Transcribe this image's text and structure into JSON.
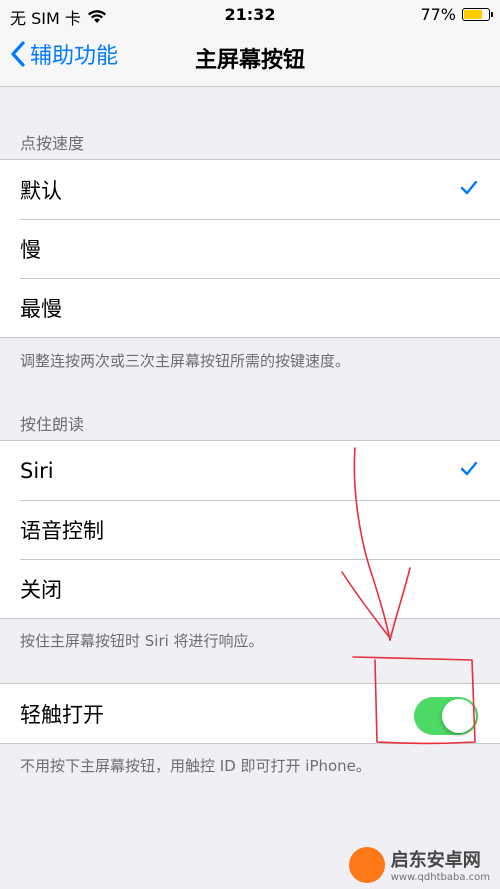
{
  "status": {
    "carrier": "无 SIM 卡",
    "time": "21:32",
    "battery": "77%",
    "battery_level": 0.77
  },
  "nav": {
    "back_label": "辅助功能",
    "title": "主屏幕按钮"
  },
  "click_speed": {
    "header": "点按速度",
    "items": [
      {
        "label": "默认",
        "checked": true
      },
      {
        "label": "慢"
      },
      {
        "label": "最慢"
      }
    ],
    "footer": "调整连按两次或三次主屏幕按钮所需的按键速度。"
  },
  "press_hold": {
    "header": "按住朗读",
    "items": [
      {
        "label": "Siri",
        "checked": true
      },
      {
        "label": "语音控制"
      },
      {
        "label": "关闭"
      }
    ],
    "footer": "按住主屏幕按钮时 Siri 将进行响应。"
  },
  "rest_to_open": {
    "label": "轻触打开",
    "on": true,
    "footer": "不用按下主屏幕按钮，用触控 ID 即可打开 iPhone。"
  },
  "colors": {
    "accent": "#007aff",
    "toggle_on": "#4cd964",
    "annotation": "#e8303a"
  },
  "watermark": {
    "name": "启东安卓网",
    "url": "www.qdhtbaba.com"
  }
}
